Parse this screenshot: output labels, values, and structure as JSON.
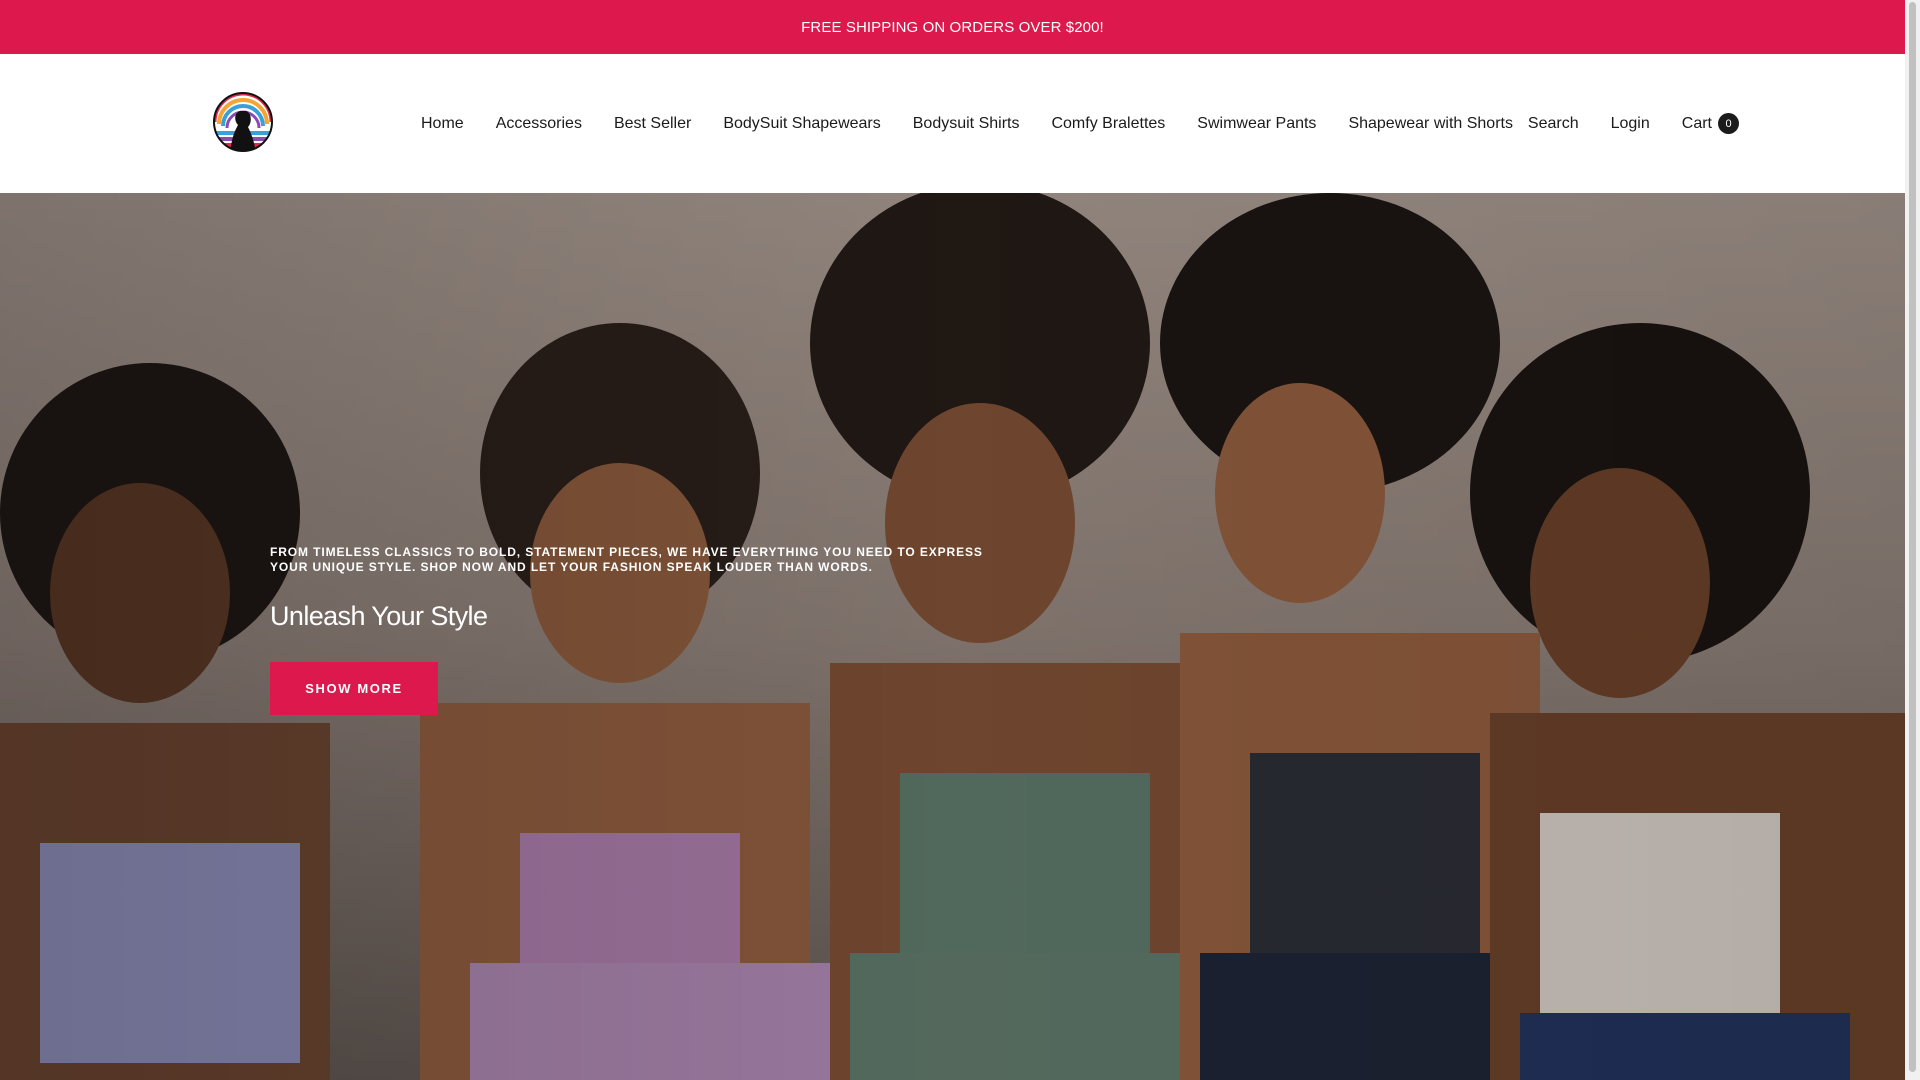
{
  "announcement": {
    "text": "FREE SHIPPING ON ORDERS OVER $200!"
  },
  "header": {
    "logo_icon": "rainbow-silhouette-logo",
    "nav": [
      {
        "label": "Home"
      },
      {
        "label": "Accessories"
      },
      {
        "label": "Best Seller"
      },
      {
        "label": "BodySuit Shapewears"
      },
      {
        "label": "Bodysuit Shirts"
      },
      {
        "label": "Comfy Bralettes"
      },
      {
        "label": "Swimwear Pants"
      },
      {
        "label": "Shapewear with Shorts"
      }
    ],
    "search_label": "Search",
    "login_label": "Login",
    "cart_label": "Cart",
    "cart_count": "0"
  },
  "hero": {
    "subheading": "FROM TIMELESS CLASSICS TO BOLD, STATEMENT PIECES, WE HAVE EVERYTHING YOU NEED TO EXPRESS YOUR UNIQUE STYLE. SHOP NOW AND LET YOUR FASHION SPEAK LOUDER THAN WORDS.",
    "heading": "Unleash Your Style",
    "button_label": "SHOW MORE"
  },
  "colors": {
    "accent": "#dc184d",
    "text": "#1c1b1b",
    "background": "#ffffff"
  }
}
